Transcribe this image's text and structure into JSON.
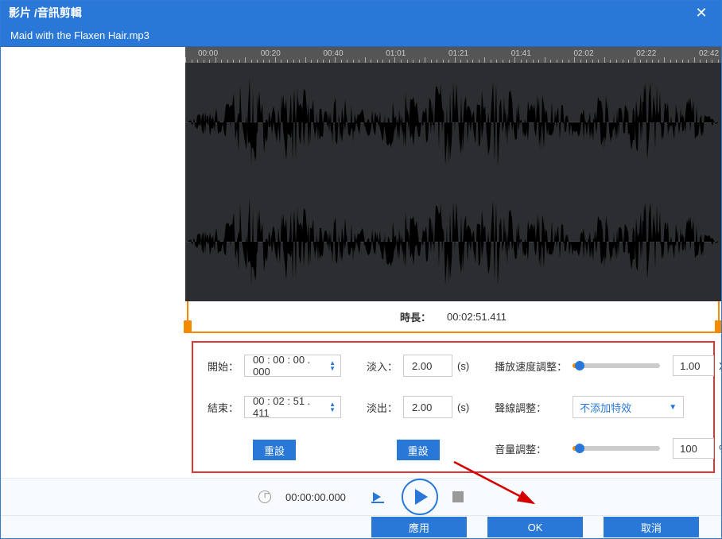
{
  "title": "影片 /音訊剪輯",
  "filename": "Maid with the Flaxen Hair.mp3",
  "ruler_ticks": [
    "00:00",
    "00:20",
    "00:40",
    "01:01",
    "01:21",
    "01:41",
    "02:02",
    "02:22",
    "02:42"
  ],
  "duration_label": "時長：",
  "duration_value": "00:02:51.411",
  "start_label": "開始：",
  "start_value": "00 : 00 : 00 . 000",
  "end_label": "結束：",
  "end_value": "00 : 02 : 51 . 411",
  "fadein_label": "淡入：",
  "fadein_value": "2.00",
  "fadeout_label": "淡出：",
  "fadeout_value": "2.00",
  "seconds_unit": "(s)",
  "reset_label": "重設",
  "speed_label": "播放速度調整：",
  "speed_value": "1.00",
  "speed_unit": "X",
  "audio_line_label": "聲線調整：",
  "audio_line_value": "不添加特效",
  "volume_label": "音量調整：",
  "volume_value": "100",
  "volume_unit": "%",
  "transport_time": "00:00:00.000",
  "apply_label": "應用",
  "ok_label": "OK",
  "cancel_label": "取消"
}
